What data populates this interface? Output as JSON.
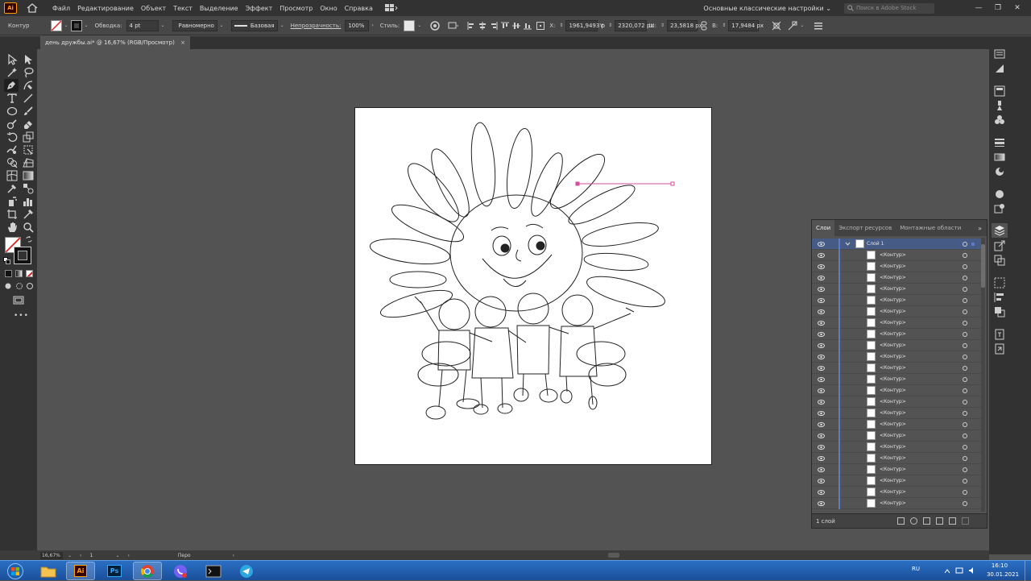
{
  "app": {
    "logo_text": "Ai"
  },
  "menu": {
    "items": [
      "Файл",
      "Редактирование",
      "Объект",
      "Текст",
      "Выделение",
      "Эффект",
      "Просмотр",
      "Окно",
      "Справка"
    ],
    "workspace": "Основные классические настройки",
    "search_placeholder": "Поиск в Adobe Stock"
  },
  "control_bar": {
    "selection_label": "Контур",
    "stroke_label": "Обводка:",
    "stroke_weight": "4 pt",
    "profile_label": "Равномерно",
    "brush_label": "Базовая",
    "opacity_label": "Непрозрачность:",
    "opacity_value": "100%",
    "style_label": "Стиль:",
    "x_label": "X:",
    "x_value": "1961,9493 p",
    "y_label": "Y:",
    "y_value": "2320,072 px",
    "w_label": "Ш:",
    "w_value": "23,5818 px",
    "h_label": "В:",
    "h_value": "17,9484 px"
  },
  "document": {
    "tab_title": "день дружбы.ai* @ 16,67% (RGB/Просмотр)",
    "close_glyph": "×"
  },
  "layers_panel": {
    "tabs": [
      "Слои",
      "Экспорт ресурсов",
      "Монтажные области"
    ],
    "more_glyph": "»",
    "top_layer": "Слой 1",
    "rows": [
      "<Контур>",
      "<Контур>",
      "<Контур>",
      "<Контур>",
      "<Контур>",
      "<Контур>",
      "<Контур>",
      "<Контур>",
      "<Контур>",
      "<Контур>",
      "<Контур>",
      "<Контур>",
      "<Контур>",
      "<Контур>",
      "<Контур>",
      "<Контур>",
      "<Контур>",
      "<Контур>",
      "<Контур>",
      "<Контур>",
      "<Контур>",
      "<Контур>",
      "<Контур>"
    ],
    "footer_count": "1 слой"
  },
  "status_bar": {
    "zoom": "16,67%",
    "artboard_number": "1",
    "tool_name": "Перо"
  },
  "taskbar": {
    "apps": [
      "Ai",
      "Ps"
    ],
    "language": "RU",
    "time": "16:10",
    "date": "30.01.2021"
  },
  "colors": {
    "ui_dark": "#323232",
    "ui_mid": "#535353",
    "layer_selected": "#465b86",
    "layer_color_bar": "#5a7cc8",
    "ai_orange": "#ff9a00",
    "path_selection": "#d24fa0"
  }
}
